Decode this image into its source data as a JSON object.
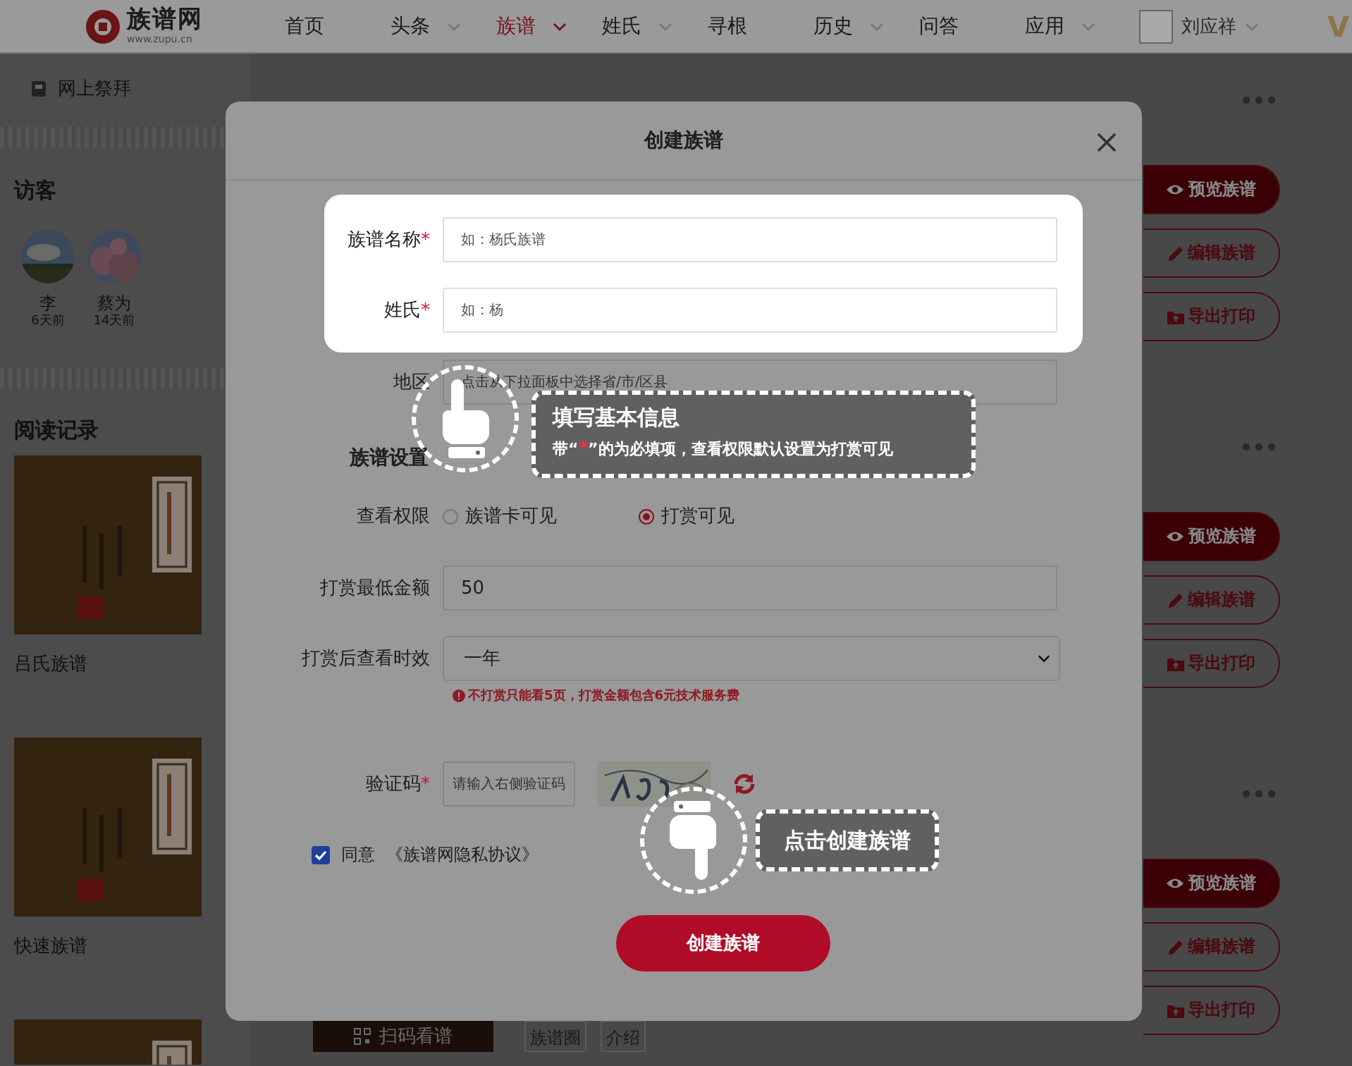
{
  "header": {
    "logo_title": "族谱网",
    "logo_url": "www.zupu.cn",
    "nav": [
      {
        "label": "首页",
        "caret": false,
        "selected": false
      },
      {
        "label": "头条",
        "caret": true,
        "selected": false
      },
      {
        "label": "族谱",
        "caret": true,
        "selected": true
      },
      {
        "label": "姓氏",
        "caret": true,
        "selected": false
      },
      {
        "label": "寻根",
        "caret": false,
        "selected": false
      },
      {
        "label": "历史",
        "caret": true,
        "selected": false
      },
      {
        "label": "问答",
        "caret": false,
        "selected": false
      },
      {
        "label": "应用",
        "caret": true,
        "selected": false
      }
    ],
    "user": {
      "name": "刘应祥"
    },
    "vip": "V"
  },
  "sidebar": {
    "memorial": "网上祭拜",
    "visitors_title": "访客",
    "visitors": [
      {
        "name": "李",
        "time": "6天前"
      },
      {
        "name": "蔡为",
        "time": "14天前"
      }
    ],
    "history_title": "阅读记录",
    "books": [
      {
        "title": "吕氏族谱"
      },
      {
        "title": "快速族谱"
      },
      {
        "kind": "picture"
      }
    ]
  },
  "cards": [
    {
      "actions": [
        {
          "kind": "preview",
          "label": "预览族谱"
        },
        {
          "kind": "edit",
          "label": "编辑族谱"
        },
        {
          "kind": "export",
          "label": "导出打印"
        }
      ]
    },
    {
      "actions": [
        {
          "kind": "preview",
          "label": "预览族谱"
        },
        {
          "kind": "edit",
          "label": "编辑族谱"
        },
        {
          "kind": "export",
          "label": "导出打印"
        }
      ]
    },
    {
      "actions": [
        {
          "kind": "preview",
          "label": "预览族谱"
        },
        {
          "kind": "edit",
          "label": "编辑族谱"
        },
        {
          "kind": "export",
          "label": "导出打印"
        }
      ],
      "footer": {
        "scan": "扫码看谱",
        "tags": [
          "族谱圈",
          "介绍"
        ]
      }
    }
  ],
  "modal": {
    "title": "创建族谱",
    "spotlight_fields": [
      {
        "label": "族谱名称",
        "required_mark": "*",
        "placeholder": "如：杨氏族谱"
      },
      {
        "label": "姓氏",
        "required_mark": "*",
        "placeholder": "如：杨"
      }
    ],
    "fields": [
      {
        "label": "地区",
        "placeholder": "点击从下拉面板中选择省/市/区县"
      }
    ],
    "section_title": "族谱设置",
    "settings": [
      {
        "kind": "radio",
        "label": "查看权限",
        "options": [
          {
            "label": "族谱卡可见",
            "selected": false
          },
          {
            "label": "打赏可见",
            "selected": true
          }
        ]
      },
      {
        "kind": "text",
        "label": "打赏最低金额",
        "value": "50"
      },
      {
        "kind": "select",
        "label": "打赏后查看时效",
        "value": "一年",
        "note": "不打赏只能看5页，打赏金额包含6元技术服务费"
      }
    ],
    "captcha": {
      "label": "验证码",
      "required_mark": "*",
      "placeholder": "请输入右侧验证码"
    },
    "agree": {
      "checked": true,
      "label": "同意",
      "link": "《族谱网隐私协议》"
    },
    "submit": "创建族谱"
  },
  "guides": [
    {
      "kind": "up",
      "title": "填写基本信息",
      "text_parts": [
        {
          "kind": "plain",
          "text": "带“"
        },
        {
          "kind": "required",
          "text": "*"
        },
        {
          "kind": "plain",
          "text": "”的为必填项，查看权限默认设置为打赏可见"
        }
      ]
    },
    {
      "kind": "down",
      "title": "点击创建族谱"
    }
  ]
}
